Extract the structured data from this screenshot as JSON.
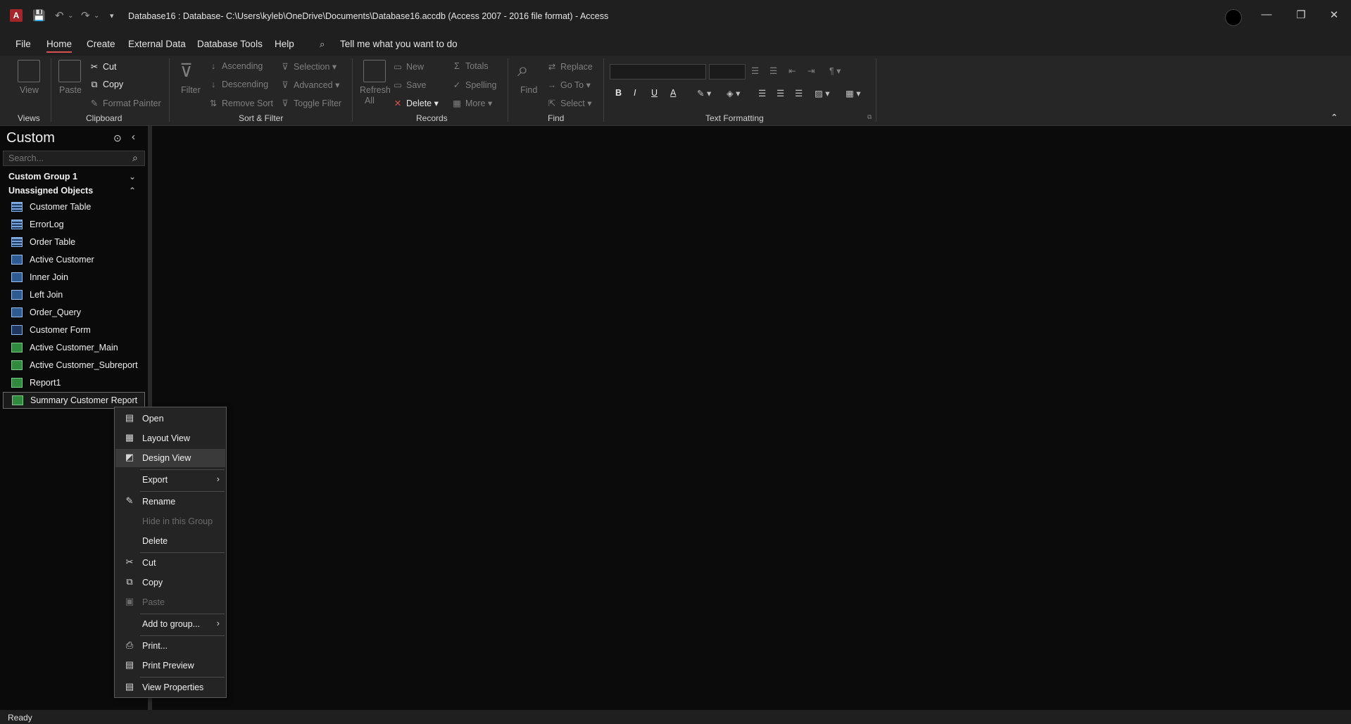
{
  "titlebar": {
    "title": "Database16 : Database- C:\\Users\\kyleb\\OneDrive\\Documents\\Database16.accdb (Access 2007 - 2016 file format)  -  Access",
    "minimize": "—",
    "restore": "❐",
    "close": "✕"
  },
  "menu": {
    "items": [
      "File",
      "Home",
      "Create",
      "External Data",
      "Database Tools",
      "Help"
    ],
    "active": "Home",
    "tell_me": "Tell me what you want to do"
  },
  "ribbon": {
    "views": {
      "view": "View",
      "label": "Views"
    },
    "clipboard": {
      "paste": "Paste",
      "cut": "Cut",
      "copy": "Copy",
      "format_painter": "Format Painter",
      "label": "Clipboard"
    },
    "sort_filter": {
      "filter": "Filter",
      "ascending": "Ascending",
      "descending": "Descending",
      "remove_sort": "Remove Sort",
      "selection": "Selection",
      "advanced": "Advanced",
      "toggle_filter": "Toggle Filter",
      "label": "Sort & Filter"
    },
    "records": {
      "refresh": "Refresh",
      "refresh_all": "All",
      "new": "New",
      "save": "Save",
      "delete": "Delete",
      "totals": "Totals",
      "spelling": "Spelling",
      "more": "More",
      "label": "Records"
    },
    "find": {
      "find": "Find",
      "replace": "Replace",
      "goto": "Go To",
      "select": "Select",
      "label": "Find"
    },
    "text_formatting": {
      "label": "Text Formatting",
      "bold": "B",
      "italic": "I",
      "underline": "U",
      "font_color": "A"
    }
  },
  "nav": {
    "title": "Custom",
    "search_placeholder": "Search...",
    "groups": [
      {
        "label": "Custom Group 1",
        "state": "collapsed"
      },
      {
        "label": "Unassigned Objects",
        "state": "expanded"
      }
    ],
    "objects": [
      {
        "label": "Customer Table",
        "type": "table"
      },
      {
        "label": "ErrorLog",
        "type": "table"
      },
      {
        "label": "Order Table",
        "type": "table"
      },
      {
        "label": "Active Customer",
        "type": "query"
      },
      {
        "label": "Inner Join",
        "type": "query"
      },
      {
        "label": "Left Join",
        "type": "query"
      },
      {
        "label": "Order_Query",
        "type": "query"
      },
      {
        "label": "Customer Form",
        "type": "form"
      },
      {
        "label": "Active Customer_Main",
        "type": "report"
      },
      {
        "label": "Active Customer_Subreport",
        "type": "report"
      },
      {
        "label": "Report1",
        "type": "report"
      },
      {
        "label": "Summary Customer Report",
        "type": "report",
        "selected": true
      }
    ]
  },
  "context_menu": {
    "items": [
      {
        "label": "Open",
        "icon": "open-icon"
      },
      {
        "label": "Layout View",
        "icon": "layout-view-icon"
      },
      {
        "label": "Design View",
        "icon": "design-view-icon",
        "highlighted": true
      },
      {
        "label": "Export",
        "submenu": true
      },
      {
        "label": "Rename",
        "icon": "rename-icon"
      },
      {
        "label": "Hide in this Group",
        "disabled": true
      },
      {
        "label": "Delete"
      },
      {
        "label": "Cut",
        "icon": "cut-icon"
      },
      {
        "label": "Copy",
        "icon": "copy-icon"
      },
      {
        "label": "Paste",
        "icon": "paste-icon",
        "disabled": true
      },
      {
        "label": "Add to group...",
        "submenu": true
      },
      {
        "label": "Print...",
        "icon": "print-icon"
      },
      {
        "label": "Print Preview",
        "icon": "print-preview-icon"
      },
      {
        "label": "View Properties",
        "icon": "properties-icon"
      }
    ]
  },
  "status": {
    "text": "Ready"
  }
}
